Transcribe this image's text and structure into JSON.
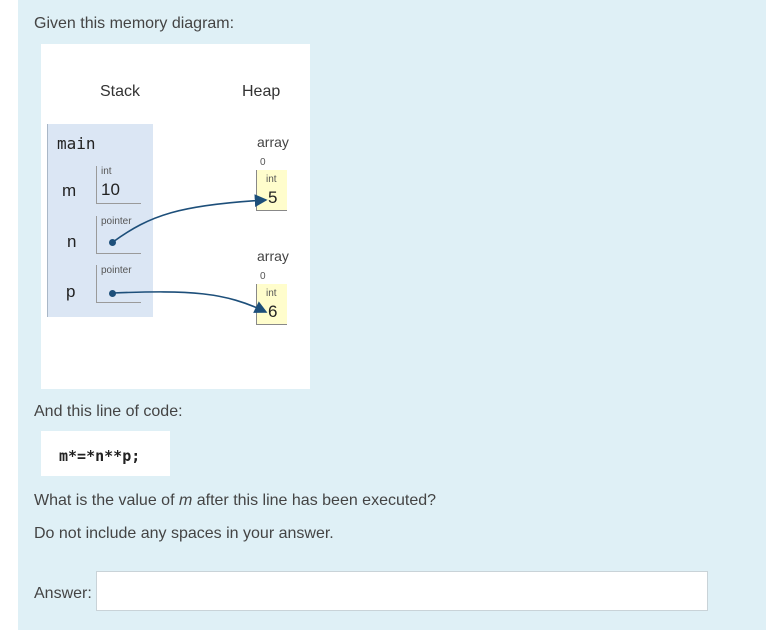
{
  "question": {
    "intro": "Given this memory diagram:",
    "code_intro": "And this line of code:",
    "code": "m*=*n**p;",
    "question_part1": "What is the value of ",
    "question_var": "m",
    "question_part2": " after this line has been executed?",
    "instruction": "Do not include any spaces in your answer.",
    "answer_label": "Answer:",
    "answer_value": ""
  },
  "diagram": {
    "stack_header": "Stack",
    "heap_header": "Heap",
    "frame_name": "main",
    "vars": [
      {
        "name": "m",
        "type": "int",
        "value": "10"
      },
      {
        "name": "n",
        "type": "pointer",
        "value": ""
      },
      {
        "name": "p",
        "type": "pointer",
        "value": ""
      }
    ],
    "heap": [
      {
        "label": "array",
        "index": "0",
        "type": "int",
        "value": "5"
      },
      {
        "label": "array",
        "index": "0",
        "type": "int",
        "value": "6"
      }
    ]
  },
  "colors": {
    "panel_bg": "#dff0f6",
    "frame_bg": "#dbe6f4",
    "heap_cell_bg": "#fffdcc",
    "arrow": "#1d4f7a"
  }
}
